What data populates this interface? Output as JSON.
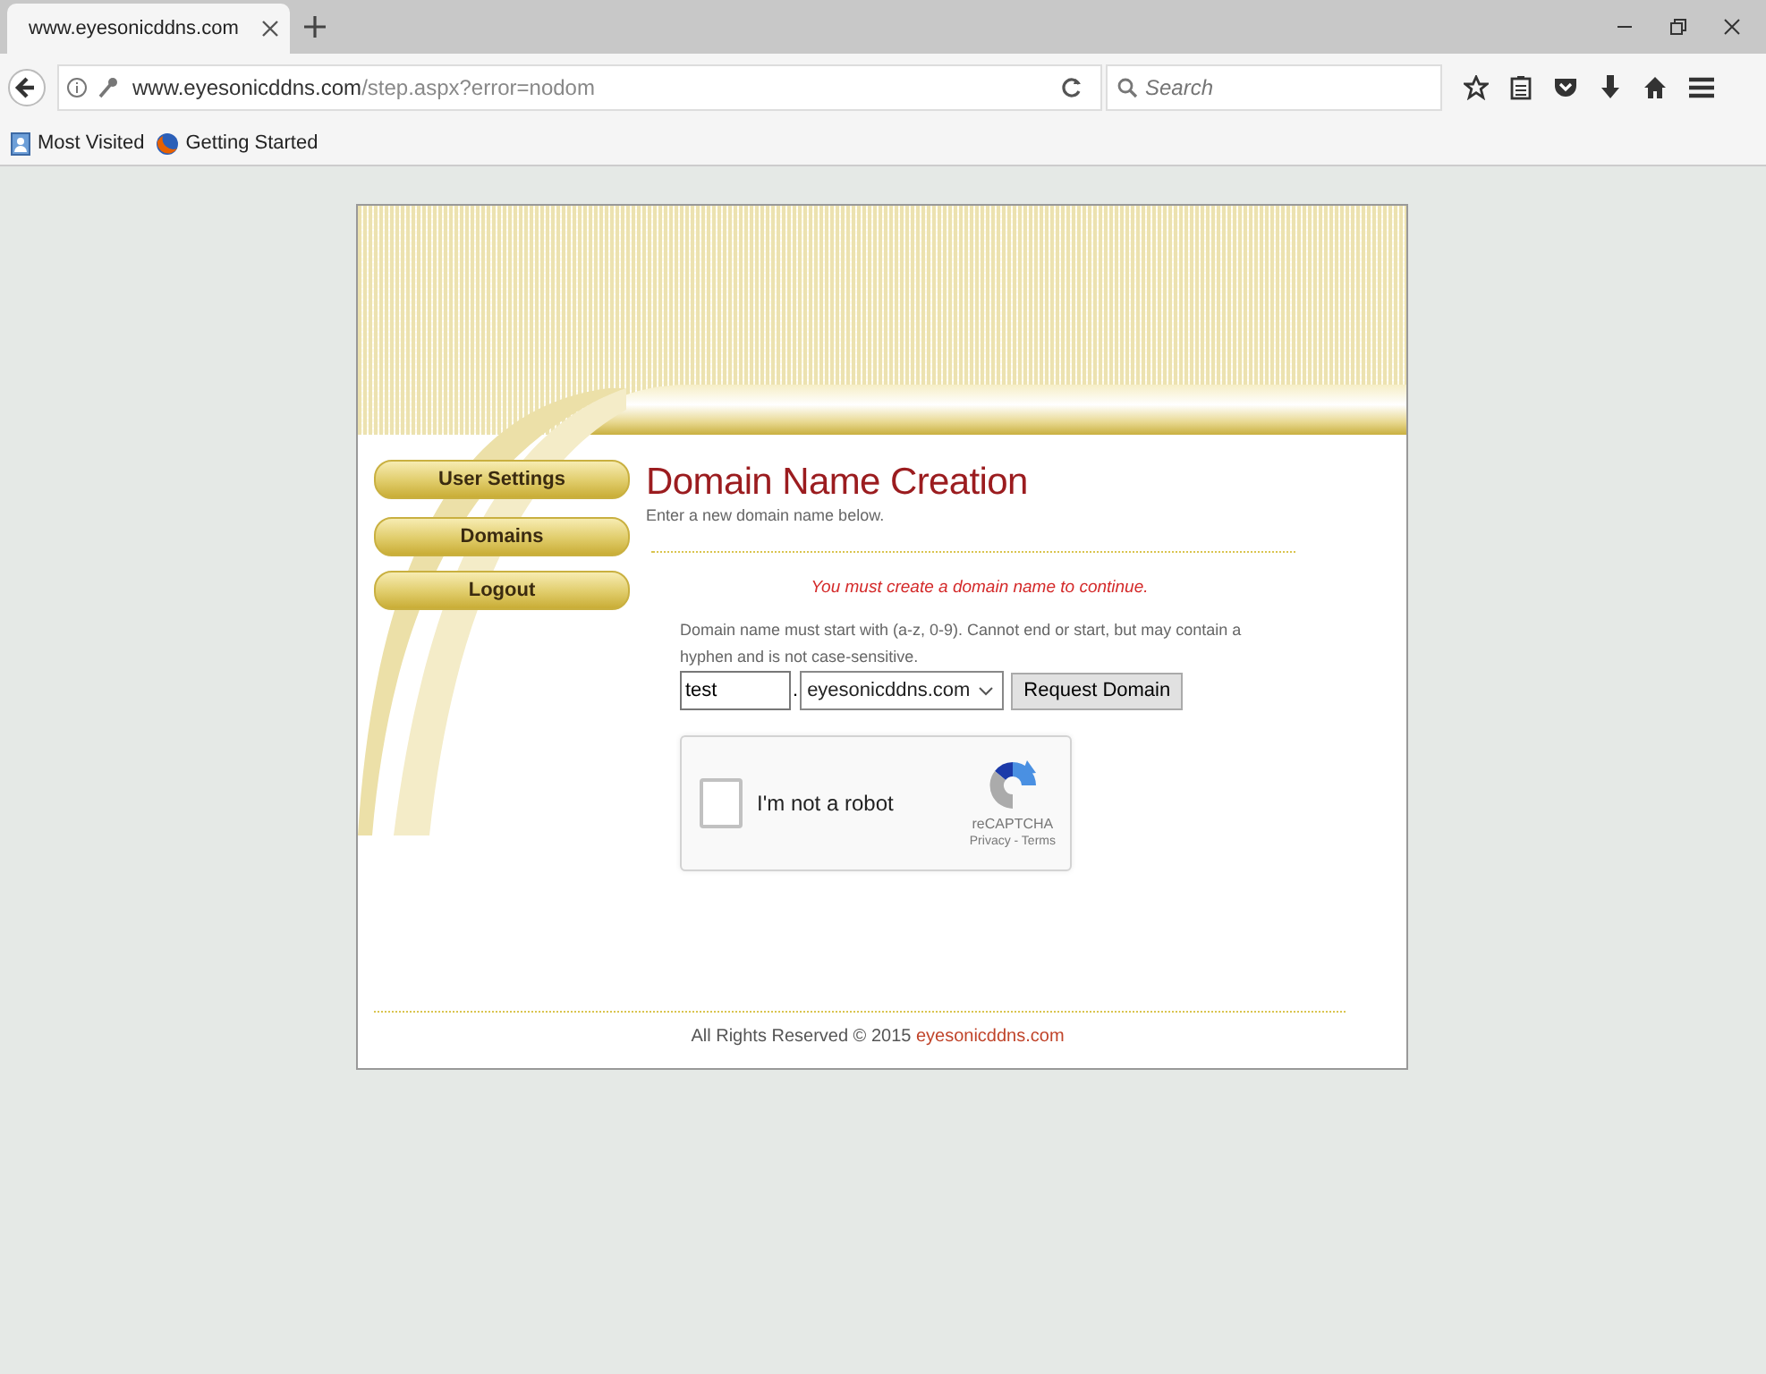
{
  "browser": {
    "tab_title": "www.eyesonicddns.com",
    "url_host": "www.eyesonicddns.com",
    "url_path": "/step.aspx?error=nodom",
    "search_placeholder": "Search",
    "bookmarks": [
      {
        "label": "Most Visited",
        "kind": "folder"
      },
      {
        "label": "Getting Started",
        "kind": "firefox"
      }
    ]
  },
  "sidebar": {
    "buttons": [
      "User Settings",
      "Domains",
      "Logout"
    ]
  },
  "main": {
    "title": "Domain Name Creation",
    "subtitle": "Enter a new domain name below.",
    "error": "You must create a domain name to continue.",
    "help": "Domain name must start with (a-z, 0-9). Cannot end or start, but may contain a hyphen and is not case-sensitive.",
    "domain_value": "test",
    "separator": ".",
    "suffix": "eyesonicddns.com",
    "button": "Request Domain",
    "captcha": {
      "label": "I'm not a robot",
      "checked": false,
      "brand": "reCAPTCHA",
      "links": "Privacy - Terms"
    }
  },
  "footer": {
    "text": "All Rights Reserved © 2015",
    "link": "eyesonicddns.com"
  }
}
